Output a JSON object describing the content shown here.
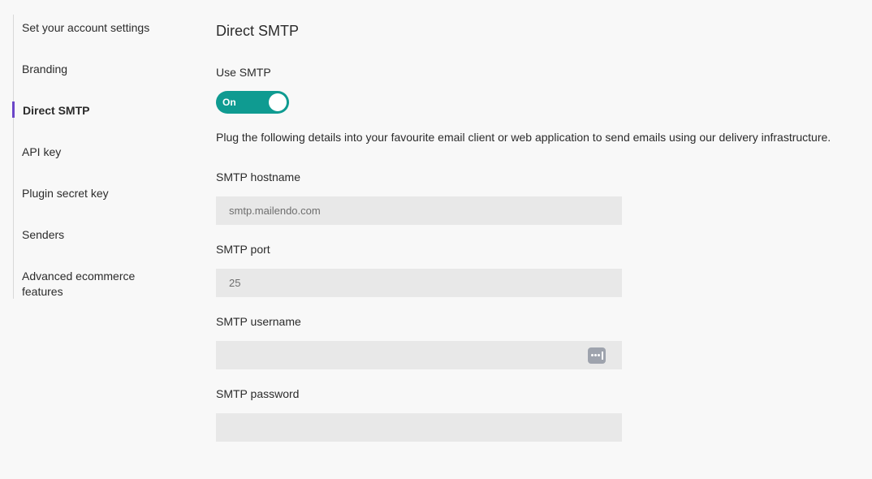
{
  "sidebar": {
    "items": [
      {
        "label": "Set your account settings"
      },
      {
        "label": "Branding"
      },
      {
        "label": "Direct SMTP",
        "active": true
      },
      {
        "label": "API key"
      },
      {
        "label": "Plugin secret key"
      },
      {
        "label": "Senders"
      },
      {
        "label": "Advanced ecommerce features"
      }
    ],
    "active_color": "#6b46c8"
  },
  "main": {
    "title": "Direct SMTP",
    "use_smtp": {
      "label": "Use SMTP",
      "toggle_text": "On",
      "enabled": true,
      "toggle_color": "#0f9b91"
    },
    "description": "Plug the following details into your favourite email client or web application to send emails using our delivery infrastructure.",
    "fields": {
      "hostname": {
        "label": "SMTP hostname",
        "value": "smtp.mailendo.com"
      },
      "port": {
        "label": "SMTP port",
        "value": "25"
      },
      "username": {
        "label": "SMTP username",
        "value": "",
        "icon": "password-manager-icon"
      },
      "password": {
        "label": "SMTP password",
        "value": ""
      }
    }
  }
}
